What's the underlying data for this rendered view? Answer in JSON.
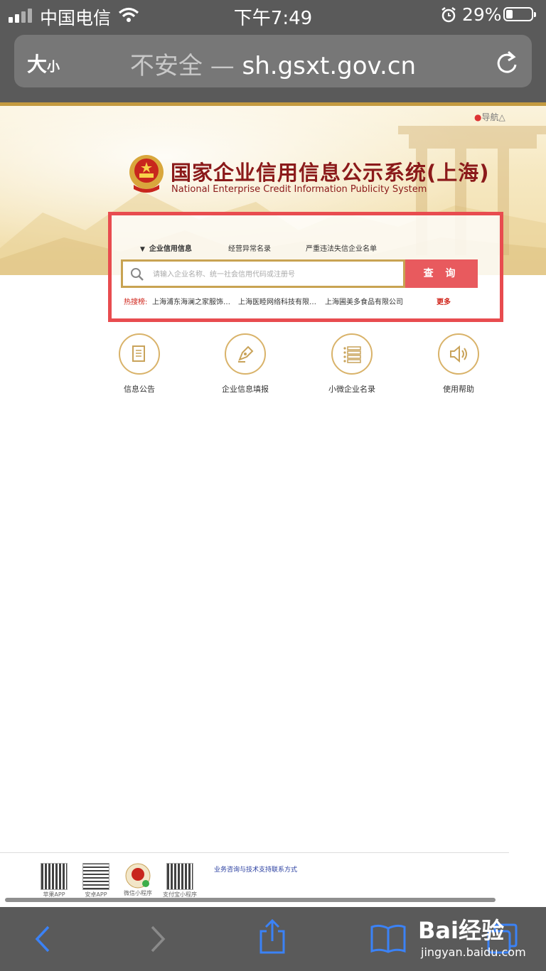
{
  "status_bar": {
    "carrier": "中国电信",
    "time": "下午7:49",
    "battery": "29%"
  },
  "address_bar": {
    "text_size_label_big": "大",
    "text_size_label_small": "小",
    "insecure_label": "不安全 —",
    "url": "sh.gsxt.gov.cn"
  },
  "page": {
    "nav_link": "导航",
    "title_cn": "国家企业信用信息公示系统(上海)",
    "title_en": "National Enterprise Credit Information Publicity System",
    "search": {
      "tabs": [
        {
          "label": "企业信用信息"
        },
        {
          "label": "经营异常名录"
        },
        {
          "label": "严重违法失信企业名单"
        }
      ],
      "placeholder": "请输入企业名称、统一社会信用代码或注册号",
      "button": "查 询",
      "hot_label": "热搜榜:",
      "hot_items": [
        "上海浦东海澜之家服饰…",
        "上海医睦网络科技有限…",
        "上海圃美多食品有限公司"
      ],
      "more": "更多"
    },
    "quick_links": [
      {
        "label": "信息公告",
        "icon": "document-icon"
      },
      {
        "label": "企业信息填报",
        "icon": "pen-icon"
      },
      {
        "label": "小微企业名录",
        "icon": "list-icon"
      },
      {
        "label": "使用帮助",
        "icon": "speaker-icon"
      }
    ],
    "footer": {
      "qr_captions": [
        "苹果APP",
        "安卓APP",
        "微信小程序",
        "支付宝小程序"
      ],
      "support_link": "业务咨询与技术支持联系方式"
    }
  },
  "watermark": {
    "brand": "Bai经验",
    "site": "jingyan.baidu.com"
  },
  "colors": {
    "accent_red": "#e84c4f",
    "gold": "#c8a352",
    "title_red": "#8b1a1a",
    "chrome": "#5a5a5a",
    "ios_blue": "#3b82f6"
  }
}
